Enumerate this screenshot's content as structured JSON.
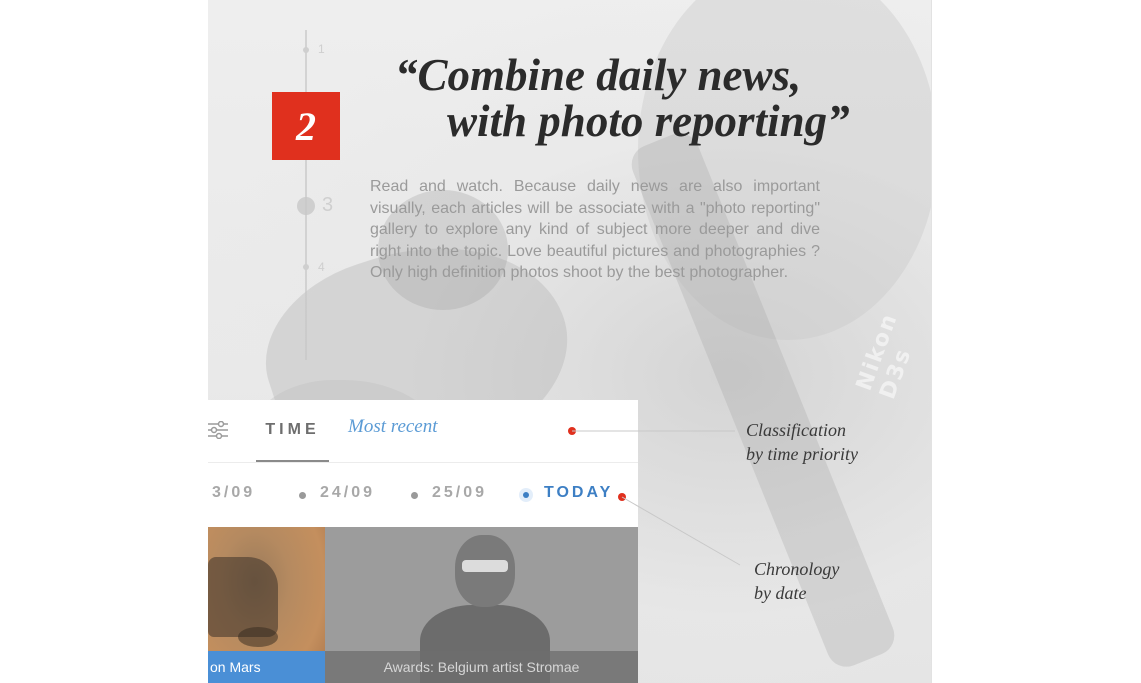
{
  "background_panel": {
    "timeline": {
      "steps": [
        {
          "label": "1"
        },
        {
          "label": "3"
        },
        {
          "label": "4"
        }
      ]
    },
    "strap_brand": "Nikon D3s"
  },
  "feature": {
    "step_number": "2",
    "headline_line1": "“Combine daily news,",
    "headline_line2": "with photo reporting”",
    "description": "Read and watch. Because daily news are also important visually, each articles will be associate with a \"photo reporting\" gallery to explore any kind of subject more deeper and dive right into the topic. Love beautiful pictures and photographies ? Only high definition photos shoot by the best photographer."
  },
  "filter_card": {
    "filter_icon": "sliders-icon",
    "tab_label": "TIME",
    "sort_value": "Most recent",
    "dates": [
      {
        "label": "3/09"
      },
      {
        "label": "24/09"
      },
      {
        "label": "25/09"
      },
      {
        "label": "TODAY",
        "active": true
      }
    ],
    "tiles": [
      {
        "caption": "on Mars"
      },
      {
        "caption": "Awards: Belgium artist Stromae"
      }
    ]
  },
  "annotations": {
    "classification_line1": "Classification",
    "classification_line2": "by time priority",
    "chronology_line1": "Chronology",
    "chronology_line2": "by date"
  },
  "colors": {
    "accent_red": "#e0301e",
    "accent_blue": "#3d7fc4",
    "caption_blue": "#4a8fd6"
  }
}
